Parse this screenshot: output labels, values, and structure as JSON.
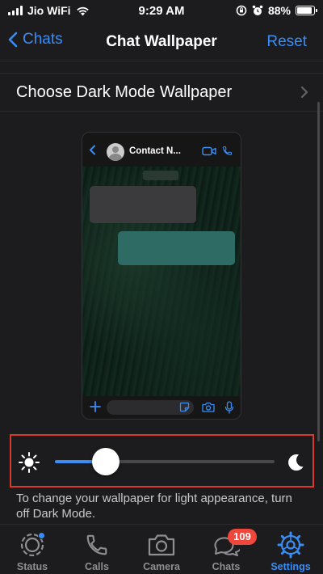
{
  "status_bar": {
    "carrier": "Jio WiFi",
    "time": "9:29 AM",
    "battery_percent": "88%",
    "battery_level": 0.88
  },
  "nav": {
    "back_label": "Chats",
    "title": "Chat Wallpaper",
    "reset_label": "Reset"
  },
  "choose_row": {
    "label": "Choose Dark Mode Wallpaper"
  },
  "preview": {
    "contact_name": "Contact N..."
  },
  "dimming_slider": {
    "value": 0.23
  },
  "info_text": "To change your wallpaper for light appearance, turn off Dark Mode.",
  "tabs": [
    {
      "label": "Status",
      "icon": "status-icon"
    },
    {
      "label": "Calls",
      "icon": "phone-icon"
    },
    {
      "label": "Camera",
      "icon": "camera-icon"
    },
    {
      "label": "Chats",
      "icon": "chat-bubbles-icon",
      "badge": "109"
    },
    {
      "label": "Settings",
      "icon": "gear-icon",
      "active": true
    }
  ],
  "colors": {
    "accent": "#3a8df5",
    "badge": "#f0473c",
    "highlight_border": "#d93a2b"
  }
}
